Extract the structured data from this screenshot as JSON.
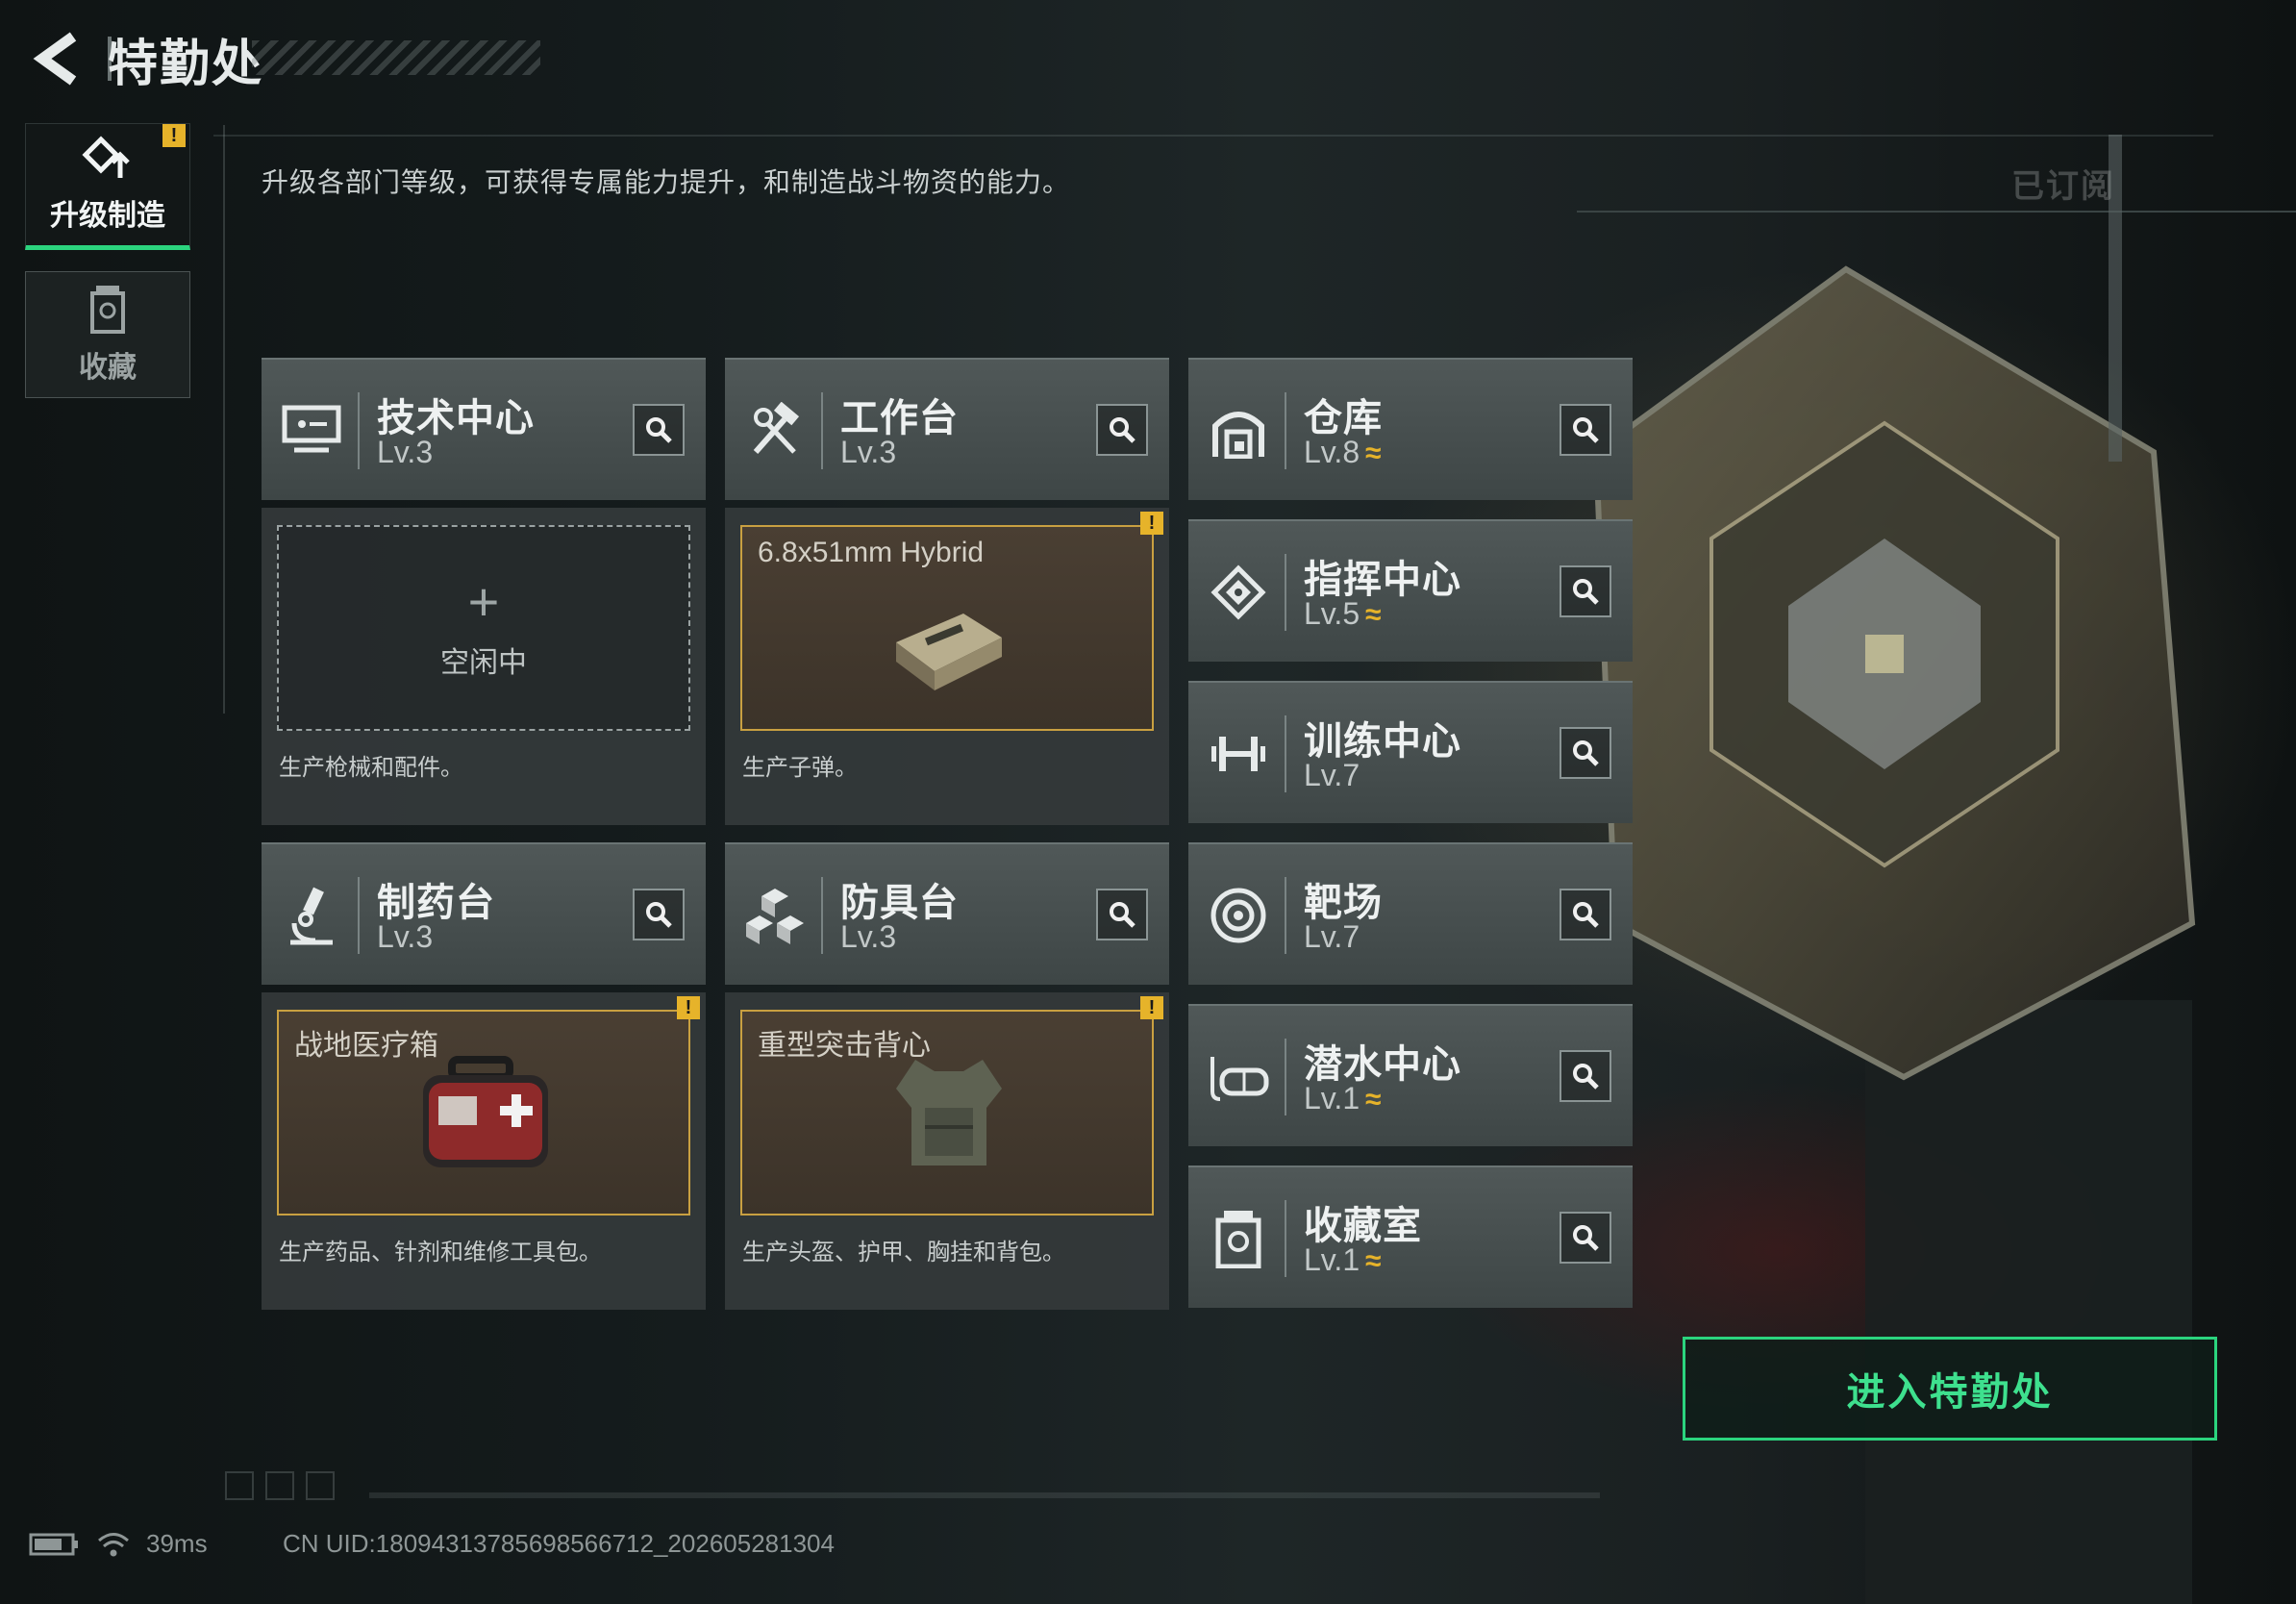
{
  "header": {
    "title": "特勤处"
  },
  "sidebar": {
    "tabs": [
      {
        "label": "升级制造",
        "active": true,
        "warning": "!"
      },
      {
        "label": "收藏",
        "active": false
      }
    ]
  },
  "description": "升级各部门等级，可获得专属能力提升，和制造战斗物资的能力。",
  "subscribed_label": "已订阅",
  "production": [
    {
      "name": "技术中心",
      "level": "Lv.3",
      "slot_state": "idle",
      "slot_label": "空闲中",
      "caption": "生产枪械和配件。"
    },
    {
      "name": "工作台",
      "level": "Lv.3",
      "slot_state": "busy",
      "slot_item": "6.8x51mm Hybrid",
      "slot_warning": "!",
      "caption": "生产子弹。"
    },
    {
      "name": "制药台",
      "level": "Lv.3",
      "slot_state": "busy",
      "slot_item": "战地医疗箱",
      "slot_warning": "!",
      "caption": "生产药品、针剂和维修工具包。"
    },
    {
      "name": "防具台",
      "level": "Lv.3",
      "slot_state": "busy",
      "slot_item": "重型突击背心",
      "slot_warning": "!",
      "caption": "生产头盔、护甲、胸挂和背包。"
    }
  ],
  "facilities": [
    {
      "name": "仓库",
      "level": "Lv.8",
      "upgradable": true,
      "icon": "warehouse-icon"
    },
    {
      "name": "指挥中心",
      "level": "Lv.5",
      "upgradable": true,
      "icon": "command-chip-icon"
    },
    {
      "name": "训练中心",
      "level": "Lv.7",
      "upgradable": false,
      "icon": "dumbbell-icon"
    },
    {
      "name": "靶场",
      "level": "Lv.7",
      "upgradable": false,
      "icon": "target-icon"
    },
    {
      "name": "潜水中心",
      "level": "Lv.1",
      "upgradable": true,
      "icon": "diving-mask-icon"
    },
    {
      "name": "收藏室",
      "level": "Lv.1",
      "upgradable": true,
      "icon": "collection-icon"
    }
  ],
  "upgrade_indicator": "≈",
  "enter_button": "进入特勤处",
  "status_bar": {
    "ping": "39ms",
    "uid": "CN UID:18094313785698566712_202605281304"
  },
  "colors": {
    "accent_green": "#2bd47e",
    "warning_yellow": "#e6b32a",
    "slot_border": "#c9a041"
  }
}
